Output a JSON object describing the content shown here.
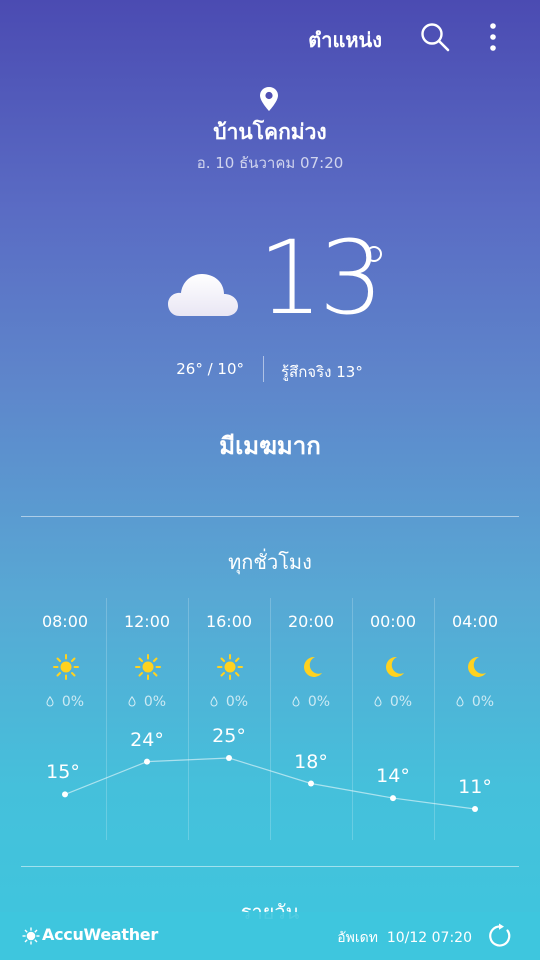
{
  "topbar": {
    "location_label": "ตำแหน่ง"
  },
  "current": {
    "city": "บ้านโคกม่วง",
    "datetime": "อ. 10 ธันวาคม 07:20",
    "temp": "13",
    "hilo": "26°  /  10°",
    "feels_like": "รู้สึกจริง 13°",
    "condition": "มีเมฆมาก"
  },
  "hourly": {
    "title": "ทุกชั่วโมง",
    "items": [
      {
        "time": "08:00",
        "icon": "sun-icon",
        "precip": "0%",
        "temp": "15°",
        "temp_value": 15
      },
      {
        "time": "12:00",
        "icon": "sun-icon",
        "precip": "0%",
        "temp": "24°",
        "temp_value": 24
      },
      {
        "time": "16:00",
        "icon": "sun-icon",
        "precip": "0%",
        "temp": "25°",
        "temp_value": 25
      },
      {
        "time": "20:00",
        "icon": "moon-icon",
        "precip": "0%",
        "temp": "18°",
        "temp_value": 18
      },
      {
        "time": "00:00",
        "icon": "moon-icon",
        "precip": "0%",
        "temp": "14°",
        "temp_value": 14
      },
      {
        "time": "04:00",
        "icon": "moon-icon",
        "precip": "0%",
        "temp": "11°",
        "temp_value": 11
      }
    ]
  },
  "daily": {
    "title": "รายวัน"
  },
  "footer": {
    "provider": "AccuWeather",
    "updated_label": "อัพเดท",
    "updated_value": "10/12  07:20"
  },
  "colors": {
    "sun": "#ffd21f",
    "moon": "#ffd21f"
  }
}
